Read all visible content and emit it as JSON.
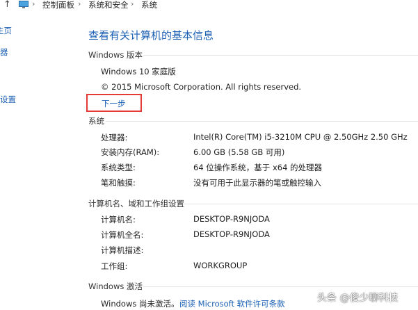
{
  "breadcrumb": {
    "items": [
      "控制面板",
      "系统和安全",
      "系统"
    ],
    "separator": "›"
  },
  "left_nav": {
    "items": [
      "主页",
      "器",
      "设置"
    ]
  },
  "title": "查看有关计算机的基本信息",
  "windows_edition": {
    "section": "Windows 版本",
    "edition": "Windows 10 家庭版",
    "copyright": "© 2015 Microsoft Corporation. All rights reserved.",
    "next_link": "下一步"
  },
  "system": {
    "section": "系统",
    "rows": [
      {
        "label": "处理器:",
        "value": "Intel(R) Core(TM) i5-3210M CPU @ 2.50GHz   2.50 GHz"
      },
      {
        "label": "安装内存(RAM):",
        "value": "6.00 GB (5.58 GB 可用)"
      },
      {
        "label": "系统类型:",
        "value": "64 位操作系统，基于 x64 的处理器"
      },
      {
        "label": "笔和触摸:",
        "value": "没有可用于此显示器的笔或触控输入"
      }
    ]
  },
  "computer": {
    "section": "计算机名、域和工作组设置",
    "rows": [
      {
        "label": "计算机名:",
        "value": "DESKTOP-R9NJODA"
      },
      {
        "label": "计算机全名:",
        "value": "DESKTOP-R9NJODA"
      },
      {
        "label": "计算机描述:",
        "value": ""
      },
      {
        "label": "工作组:",
        "value": "WORKGROUP"
      }
    ]
  },
  "activation": {
    "section": "Windows 激活",
    "status": "Windows 尚未激活。",
    "license_link": "阅读 Microsoft 软件许可条款"
  },
  "watermark": "头条 @俊少聊科技",
  "colors": {
    "link": "#1a5fb4",
    "highlight": "#e53935"
  },
  "icons": [
    "up-arrow-icon",
    "computer-icon"
  ]
}
